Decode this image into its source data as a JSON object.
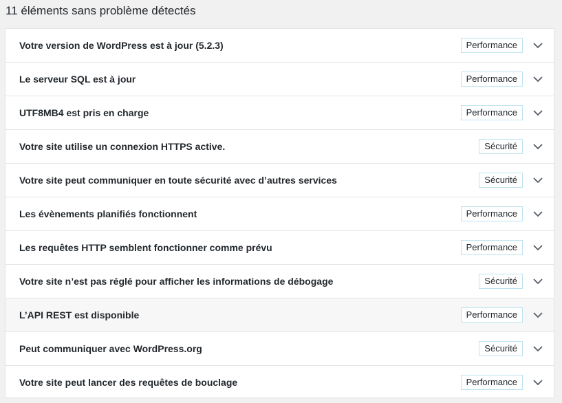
{
  "heading": "11 éléments sans problème détectés",
  "items": [
    {
      "title": "Votre version de WordPress est à jour (5.2.3)",
      "badge": "Performance"
    },
    {
      "title": "Le serveur SQL est à jour",
      "badge": "Performance"
    },
    {
      "title": "UTF8MB4 est pris en charge",
      "badge": "Performance"
    },
    {
      "title": "Votre site utilise un connexion HTTPS active.",
      "badge": "Sécurité"
    },
    {
      "title": "Votre site peut communiquer en toute sécurité avec d’autres services",
      "badge": "Sécurité"
    },
    {
      "title": "Les évènements planifiés fonctionnent",
      "badge": "Performance"
    },
    {
      "title": "Les requêtes HTTP semblent fonctionner comme prévu",
      "badge": "Performance"
    },
    {
      "title": "Votre site n’est pas réglé pour afficher les informations de débogage",
      "badge": "Sécurité"
    },
    {
      "title": "L’API REST est disponible",
      "badge": "Performance"
    },
    {
      "title": "Peut communiquer avec WordPress.org",
      "badge": "Sécurité"
    },
    {
      "title": "Votre site peut lancer des requêtes de bouclage",
      "badge": "Performance"
    }
  ],
  "icons": {
    "expand": "chevron-down-icon"
  },
  "colors": {
    "badge_border": "#bde3f0",
    "hover_row": "#f7f7f7"
  }
}
